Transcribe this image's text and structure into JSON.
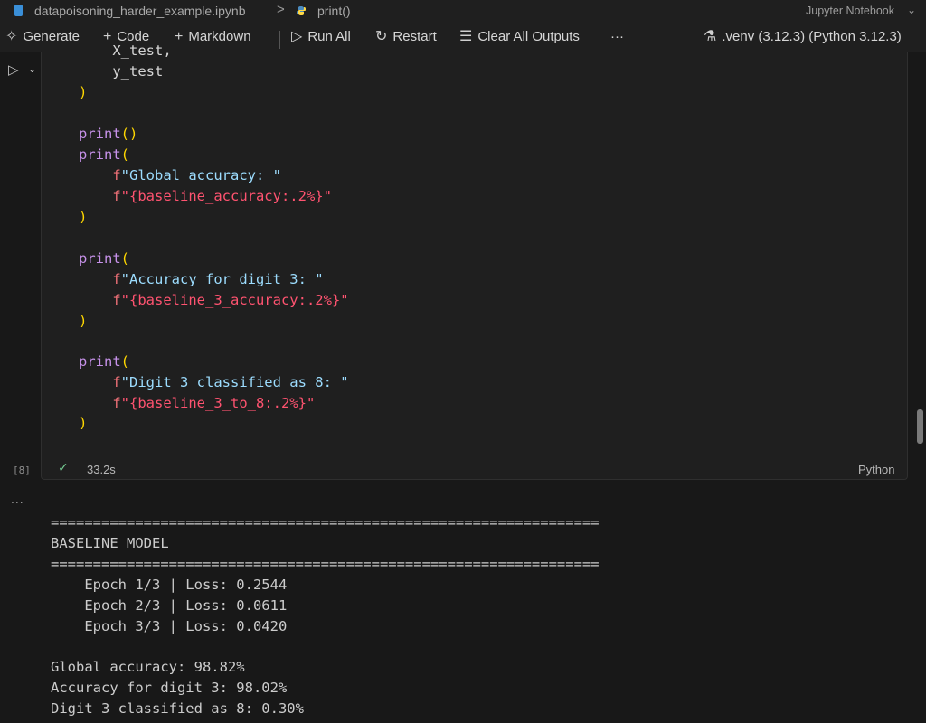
{
  "breadcrumb": {
    "file": "datapoisoning_harder_example.ipynb",
    "separator": ">",
    "symbol": "print()",
    "notebook_type": "Jupyter Notebook"
  },
  "toolbar": {
    "generate": "Generate",
    "code": "Code",
    "markdown": "Markdown",
    "run_all": "Run All",
    "restart": "Restart",
    "clear_outputs": "Clear All Outputs",
    "more": "···",
    "kernel": ".venv (3.12.3) (Python 3.12.3)"
  },
  "cell": {
    "code_lines": [
      "    X_test,",
      "    y_test",
      ")",
      "",
      "print()",
      "print(",
      "    f\"Global accuracy: \"",
      "    f\"{baseline_accuracy:.2%}\"",
      ")",
      "",
      "print(",
      "    f\"Accuracy for digit 3: \"",
      "    f\"{baseline_3_accuracy:.2%}\"",
      ")",
      "",
      "print(",
      "    f\"Digit 3 classified as 8: \"",
      "    f\"{baseline_3_to_8:.2%}\"",
      ")"
    ],
    "execution_count": "[8]",
    "duration": "33.2s",
    "language": "Python"
  },
  "output": {
    "more": "...",
    "lines": [
      "=================================================================",
      "BASELINE MODEL",
      "=================================================================",
      "    Epoch 1/3 | Loss: 0.2544",
      "    Epoch 2/3 | Loss: 0.0611",
      "    Epoch 3/3 | Loss: 0.0420",
      "",
      "Global accuracy: 98.82%",
      "Accuracy for digit 3: 98.02%",
      "Digit 3 classified as 8: 0.30%"
    ]
  }
}
